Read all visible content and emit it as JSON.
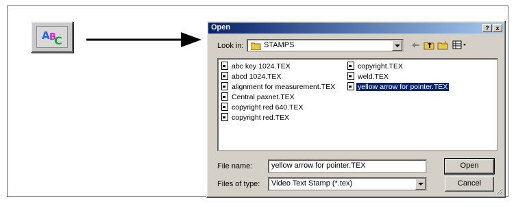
{
  "toolbar_button": {
    "letters": [
      "A",
      "B",
      "C"
    ]
  },
  "dialog": {
    "title": "Open",
    "help_glyph": "?",
    "close_glyph": "x",
    "look_in": {
      "label": "Look in:",
      "value": "STAMPS"
    },
    "files_left": [
      "abc key 1024.TEX",
      "abcd 1024.TEX",
      "alignment for measurement.TEX",
      "Central paxnet.TEX",
      "copyright red 640.TEX",
      "copyright red.TEX"
    ],
    "files_right": [
      "copyright.TEX",
      "weld.TEX",
      "yellow arrow for pointer.TEX"
    ],
    "selected_file": "yellow arrow for pointer.TEX",
    "file_name": {
      "label": "File name:",
      "value": "yellow arrow for pointer.TEX"
    },
    "file_type": {
      "label": "Files of type:",
      "value": "Video Text Stamp (*.tex)"
    },
    "open_label": "Open",
    "cancel_label": "Cancel"
  }
}
